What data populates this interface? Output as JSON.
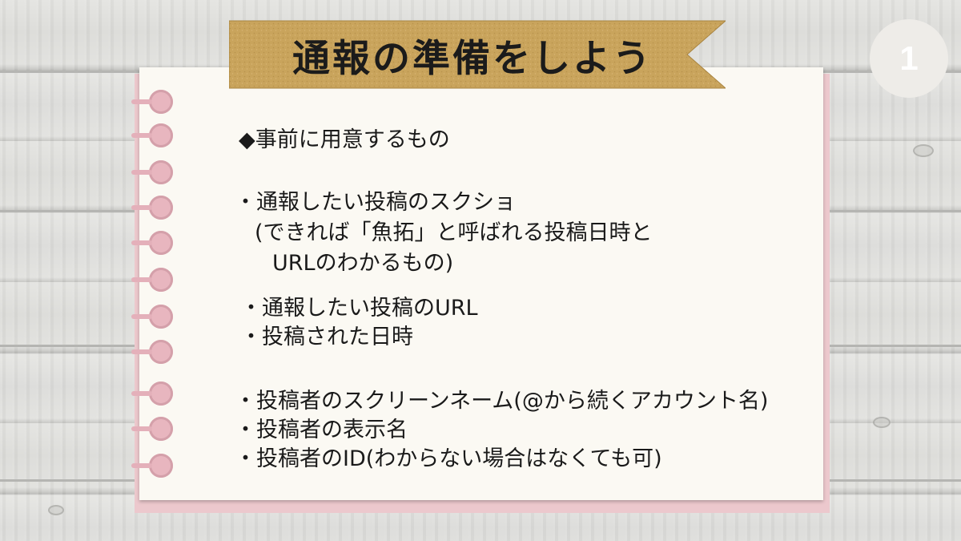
{
  "title": "通報の準備をしよう",
  "page_number": "1",
  "heading": "◆事前に用意するもの",
  "items": {
    "screenshot": "・通報したい投稿のスクショ",
    "screenshot_note1": "(できれば「魚拓」と呼ばれる投稿日時と",
    "screenshot_note2": "URLのわかるもの)",
    "url": "・通報したい投稿のURL",
    "datetime": "・投稿された日時",
    "screen_name": "・投稿者のスクリーンネーム(@から続くアカウント名)",
    "display_name": "・投稿者の表示名",
    "user_id": "・投稿者のID(わからない場合はなくても可)"
  },
  "colors": {
    "banner": "#c9a45c",
    "rings": "#e8b6bf",
    "card": "#fbf9f3"
  }
}
